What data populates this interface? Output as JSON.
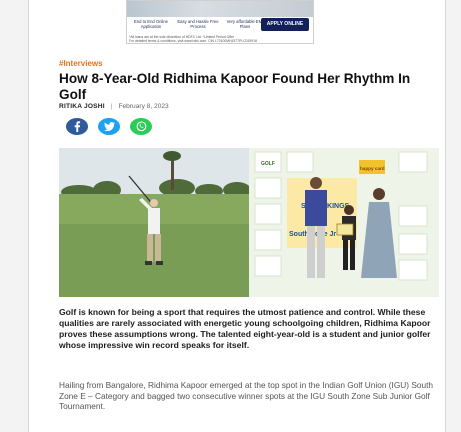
{
  "ad": {
    "features": [
      "End to End Online Application",
      "Easy and Hassle Free Process",
      "Very affordable EMI Plans"
    ],
    "cta": "APPLY ONLINE",
    "footnote_1": "*All loans are at the sole discretion of HDFC Ltd. *Limited Period Offer",
    "footnote_2": "For detailed terms & conditions, visit www.hdfc.com. CIN L70100MH1977PLC019916"
  },
  "article": {
    "category": "#Interviews",
    "title": "How 8-Year-Old Ridhima Kapoor Found Her Rhythm In Golf",
    "author": "RITIKA JOSHI",
    "separator": "|",
    "date": "February 8, 2023",
    "lead": "Golf is known for being a sport that requires the utmost patience and control. While these qualities are rarely associated with energetic young schoolgoing children, Ridhima Kapoor proves these assumptions wrong. The talented eight-year-old is a student and junior golfer whose impressive win record speaks for itself.",
    "body": "Hailing from Bangalore, Ridhima Kapoor emerged at the top spot in the Indian Golf Union (IGU) South Zone E – Category and bagged two consecutive winner spots at the IGU South Zone Sub Junior Golf Tournament."
  },
  "photo": {
    "board_labels": [
      "GOLF",
      "happy card",
      "South Zone Jr",
      "SUPER KINGS"
    ]
  },
  "share": {
    "facebook": "f",
    "twitter": "t",
    "whatsapp": "w"
  },
  "colors": {
    "category": "#e8731a",
    "facebook": "#2f5a9b",
    "twitter": "#1da1f2",
    "whatsapp": "#2ecb5a"
  },
  "icons": [
    "facebook-icon",
    "twitter-icon",
    "whatsapp-icon"
  ]
}
